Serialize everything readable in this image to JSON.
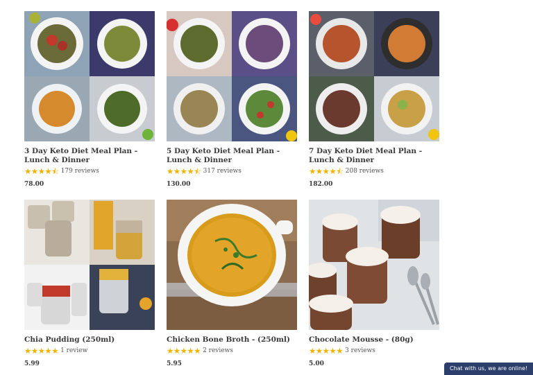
{
  "products": [
    {
      "title": "3 Day Keto Diet Meal Plan - Lunch & Dinner",
      "stars": "★★★★⯪",
      "rating": 4.5,
      "reviews": "179 reviews",
      "price": "78.00"
    },
    {
      "title": "5 Day Keto Diet Meal Plan - Lunch & Dinner",
      "stars": "★★★★⯪",
      "rating": 4.5,
      "reviews": "317 reviews",
      "price": "130.00"
    },
    {
      "title": "7 Day Keto Diet Meal Plan - Lunch & Dinner",
      "stars": "★★★★⯪",
      "rating": 4.5,
      "reviews": "208 reviews",
      "price": "182.00"
    },
    {
      "title": "Chia Pudding (250ml)",
      "stars": "★★★★★",
      "rating": 5,
      "reviews": "1 review",
      "price": "5.99"
    },
    {
      "title": "Chicken Bone Broth - (250ml)",
      "stars": "★★★★★",
      "rating": 5,
      "reviews": "2 reviews",
      "price": "5.95"
    },
    {
      "title": "Chocolate Mousse - (80g)",
      "stars": "★★★★★",
      "rating": 5,
      "reviews": "3 reviews",
      "price": "5.00"
    }
  ],
  "chat": {
    "label": "Chat with us, we are online!"
  },
  "colors": {
    "star": "#f0b400",
    "chat_bg": "#2c3e6b",
    "text": "#3a3a3a"
  }
}
